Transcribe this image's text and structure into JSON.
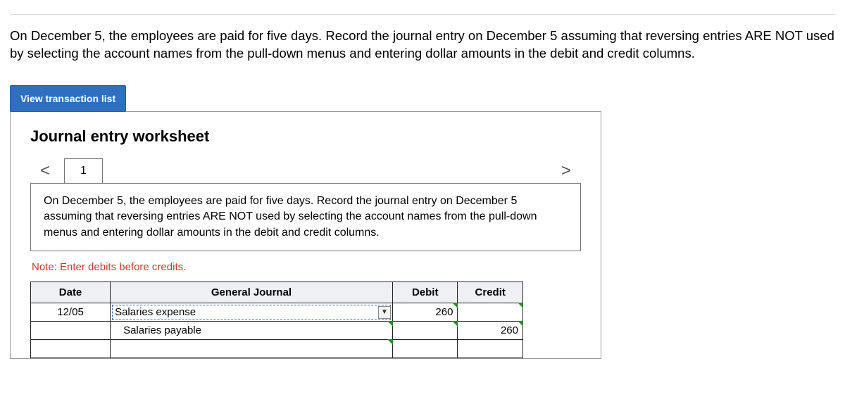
{
  "intro": "On December 5, the employees are paid for five days. Record the journal entry on December 5 assuming that reversing entries ARE NOT used by selecting the account names from the pull-down menus and entering dollar amounts in the debit and credit columns.",
  "view_btn": "View transaction list",
  "panel_title": "Journal entry worksheet",
  "nav": {
    "prev": "<",
    "next": ">"
  },
  "tab": "1",
  "instruction": "On December 5, the employees are paid for five days. Record the journal entry on December 5 assuming that reversing entries ARE NOT used by selecting the account names from the pull-down menus and entering dollar amounts in the debit and credit columns.",
  "note": "Note: Enter debits before credits.",
  "headers": {
    "date": "Date",
    "gj": "General Journal",
    "debit": "Debit",
    "credit": "Credit"
  },
  "rows": [
    {
      "date": "12/05",
      "account": "Salaries expense",
      "debit": "260",
      "credit": ""
    },
    {
      "date": "",
      "account": "Salaries payable",
      "debit": "",
      "credit": "260"
    },
    {
      "date": "",
      "account": "",
      "debit": "",
      "credit": ""
    }
  ],
  "dd_arrow": "▼"
}
